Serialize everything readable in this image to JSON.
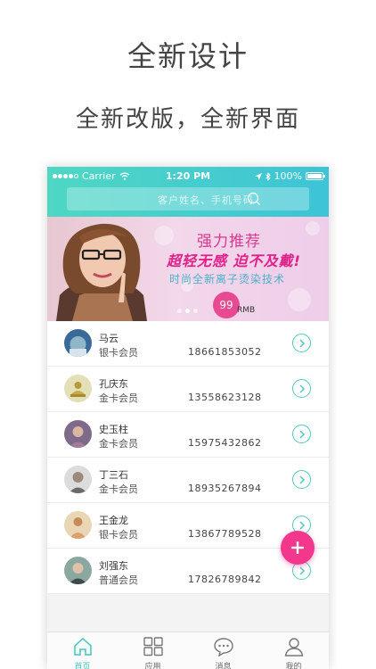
{
  "promo": {
    "title": "全新设计",
    "subtitle": "全新改版，全新界面"
  },
  "status_bar": {
    "carrier": "Carrier",
    "time": "1:20 PM",
    "battery": "100%"
  },
  "search": {
    "placeholder": "客户姓名、手机号码"
  },
  "banner": {
    "headline": "强力推荐",
    "slogan": "超轻无感 迫不及戴!",
    "tech": "时尚全新离子烫染技术",
    "price": "99",
    "price_unit": "RMB",
    "slide_count": 3,
    "active_slide": 2
  },
  "members": [
    {
      "name": "马云",
      "level": "银卡会员",
      "phone": "18661853052"
    },
    {
      "name": "孔庆东",
      "level": "金卡会员",
      "phone": "13558623128"
    },
    {
      "name": "史玉柱",
      "level": "金卡会员",
      "phone": "15975432862"
    },
    {
      "name": "丁三石",
      "level": "金卡会员",
      "phone": "18935267894"
    },
    {
      "name": "王金龙",
      "level": "银卡会员",
      "phone": "13867789528"
    },
    {
      "name": "刘强东",
      "level": "普通会员",
      "phone": "17826789842"
    }
  ],
  "tabs": [
    {
      "label": "首页",
      "icon": "home-icon",
      "active": true
    },
    {
      "label": "应用",
      "icon": "apps-grid-icon",
      "active": false
    },
    {
      "label": "消息",
      "icon": "chat-bubble-icon",
      "active": false
    },
    {
      "label": "我的",
      "icon": "user-icon",
      "active": false
    }
  ],
  "colors": {
    "accent": "#3fc7c0",
    "header_start": "#4fd7c4",
    "header_end": "#3dc4d6",
    "fab": "#f2378c"
  }
}
